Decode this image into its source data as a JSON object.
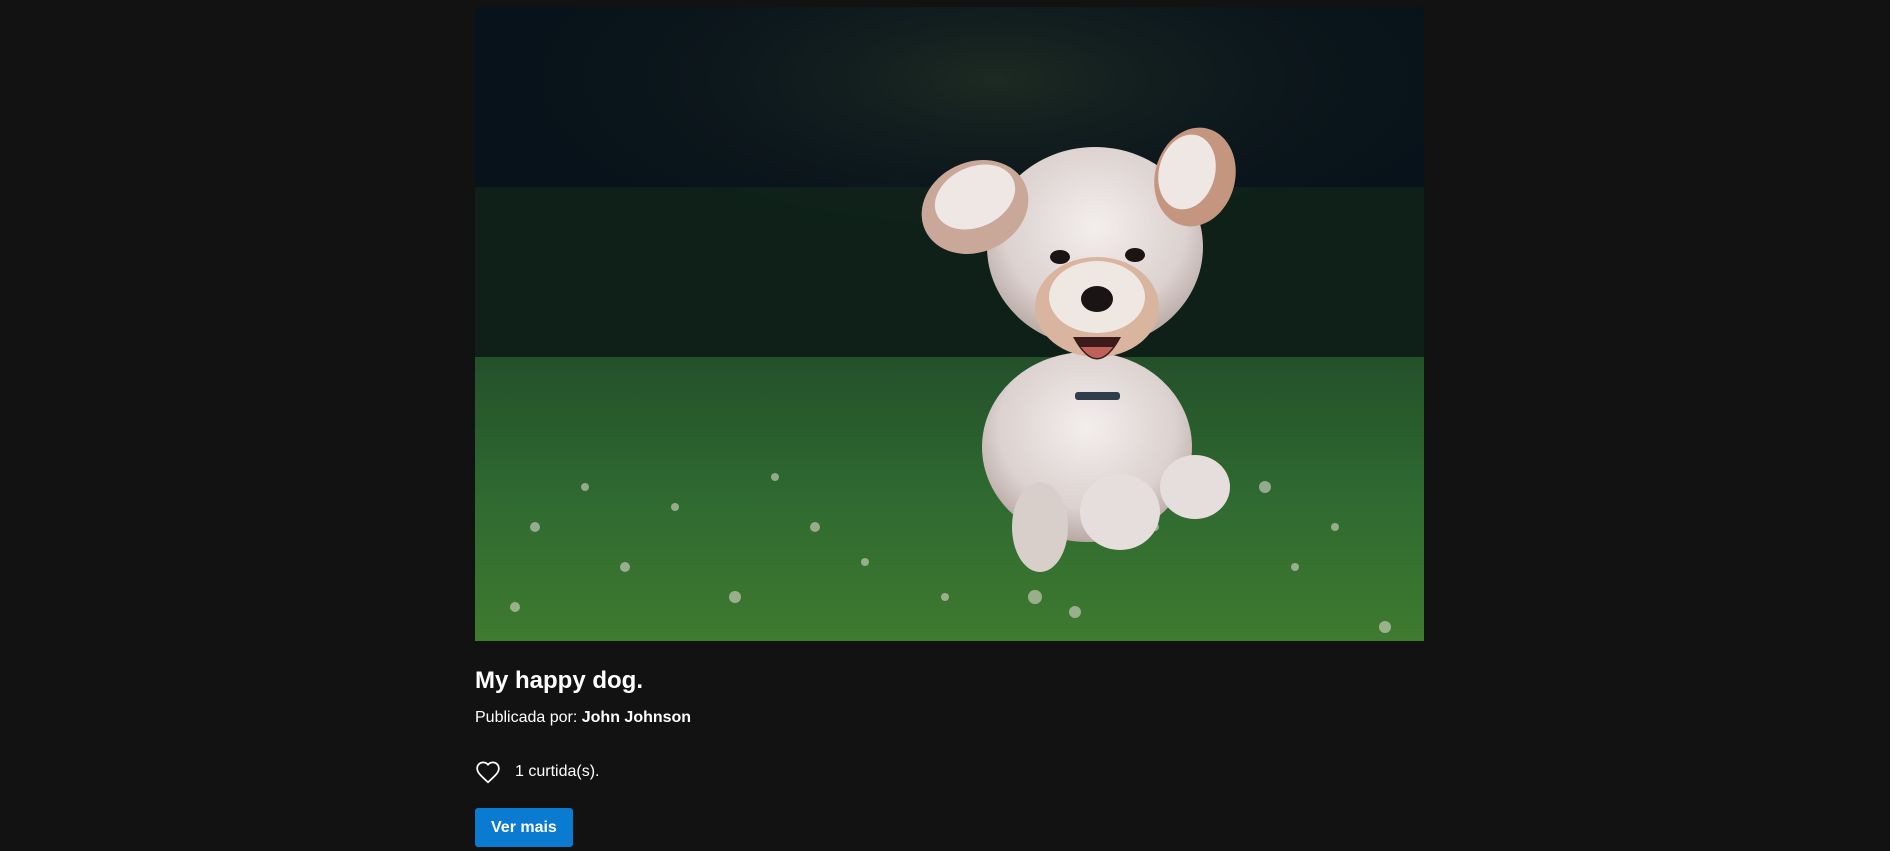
{
  "post": {
    "image_alt": "My happy dog.",
    "title": "My happy dog.",
    "published_by_label": "Publicada por:",
    "author": "John Johnson",
    "likes_text": "1 curtida(s).",
    "more_button_label": "Ver mais",
    "like_icon": "heart-outline-icon"
  },
  "colors": {
    "background": "#121212",
    "button": "#0b7ad1",
    "text": "#ffffff"
  }
}
